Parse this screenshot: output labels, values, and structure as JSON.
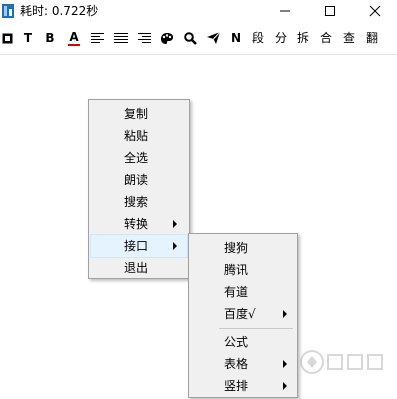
{
  "window": {
    "title": "耗时: 0.722秒",
    "minimize_glyph": "—",
    "maximize_glyph": "☐",
    "close_glyph": "✕"
  },
  "toolbar": {
    "items": [
      {
        "name": "stop-icon",
        "glyph": "◘"
      },
      {
        "name": "text-tool",
        "glyph": "T"
      },
      {
        "name": "bold",
        "glyph": "B"
      },
      {
        "name": "font-color",
        "glyph": "A"
      },
      {
        "name": "align-left-icon",
        "glyph": "≡"
      },
      {
        "name": "align-center-icon",
        "glyph": "≣"
      },
      {
        "name": "align-justify-icon",
        "glyph": "☰"
      },
      {
        "name": "palette-icon",
        "glyph": "✿"
      },
      {
        "name": "search-icon",
        "glyph": "⚲"
      },
      {
        "name": "send-icon",
        "glyph": "➤"
      },
      {
        "name": "n-button",
        "glyph": "N"
      },
      {
        "name": "paragraph",
        "glyph": "段"
      },
      {
        "name": "split",
        "glyph": "分"
      },
      {
        "name": "unpack",
        "glyph": "拆"
      },
      {
        "name": "merge",
        "glyph": "合"
      },
      {
        "name": "lookup",
        "glyph": "查"
      },
      {
        "name": "translate",
        "glyph": "翻"
      }
    ],
    "font_color_underline": "#e00000"
  },
  "context_menu": {
    "items": [
      {
        "label": "复制",
        "submenu": false
      },
      {
        "label": "粘贴",
        "submenu": false
      },
      {
        "label": "全选",
        "submenu": false
      },
      {
        "label": "朗读",
        "submenu": false
      },
      {
        "label": "搜索",
        "submenu": false
      },
      {
        "label": "转换",
        "submenu": true
      },
      {
        "label": "接口",
        "submenu": true,
        "highlighted": true
      },
      {
        "label": "退出",
        "submenu": false
      }
    ]
  },
  "submenu": {
    "items": [
      {
        "label": "搜狗",
        "submenu": false
      },
      {
        "label": "腾讯",
        "submenu": false
      },
      {
        "label": "有道",
        "submenu": false
      },
      {
        "label": "百度√",
        "submenu": true
      },
      {
        "label": "公式",
        "submenu": false
      },
      {
        "label": "表格",
        "submenu": true
      },
      {
        "label": "竖排",
        "submenu": true
      }
    ]
  },
  "colors": {
    "menu_bg": "#f0f0f0",
    "highlight": "#e5f3ff",
    "app_icon": "#1f6fb5"
  }
}
